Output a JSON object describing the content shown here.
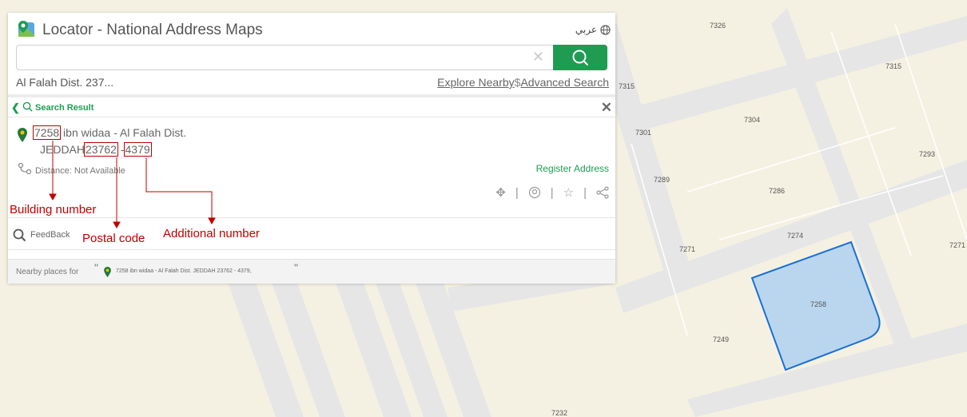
{
  "header": {
    "app_title": "Locator - National Address Maps",
    "language_label": "عربي"
  },
  "search": {
    "value": "",
    "placeholder": "",
    "query_text": "Al Falah Dist. 237...",
    "explore_nearby": "Explore Nearby",
    "link_separator": "$",
    "advanced_search": "Advanced Search"
  },
  "result": {
    "title": "Search Result",
    "building_number": "7258",
    "street_district": " ibn widaa - Al Falah Dist.",
    "city": "JEDDAH",
    "postal_code": "23762",
    "dash": "-",
    "additional_number": "4379",
    "distance": "Distance: Not Available",
    "register_label": "Register Address",
    "actions": [
      "move-icon",
      "location-icon",
      "star-icon",
      "share-icon"
    ]
  },
  "feedback": {
    "label": "FeedBack"
  },
  "nearby": {
    "label": "Nearby places for",
    "open_quote": "\"",
    "address": "7258 ibn widaa - Al Falah Dist. JEDDAH 23762 - 4379,",
    "close_quote": "\""
  },
  "annotations": {
    "building": "Building number",
    "postal": "Postal code",
    "additional": "Additional number"
  },
  "map": {
    "parcels": [
      "7326",
      "7315",
      "7315",
      "7304",
      "7301",
      "7293",
      "7289",
      "7286",
      "7274",
      "7271",
      "7271",
      "7258",
      "7249",
      "7232"
    ]
  },
  "colors": {
    "accent": "#1f9c52",
    "annotation": "#c00000",
    "highlight_parcel": "#b9d6ee",
    "highlight_border": "#1a6fd6"
  }
}
